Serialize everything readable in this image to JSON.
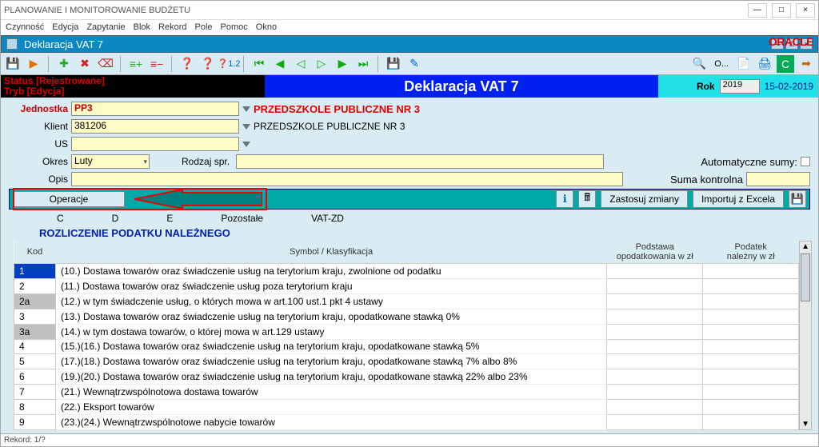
{
  "window": {
    "title": "PLANOWANIE I MONITOROWANIE BUDŻETU",
    "brand": "ORACLE"
  },
  "menu": {
    "items": [
      "Czynność",
      "Edycja",
      "Zapytanie",
      "Blok",
      "Rekord",
      "Pole",
      "Pomoc",
      "Okno"
    ]
  },
  "sub_window": {
    "title": "Deklaracja VAT 7"
  },
  "status_band": {
    "status_label": "Status [Rejestrowane]",
    "mode_label": "Tryb [Edycja]",
    "title": "Deklaracja VAT 7",
    "year_label": "Rok",
    "year_value": "2019",
    "date": "15-02-2019"
  },
  "form": {
    "jednostka_label": "Jednostka",
    "jednostka_value": "PP3",
    "jednostka_name": "PRZEDSZKOLE PUBLICZNE NR 3",
    "klient_label": "Klient",
    "klient_value": "381206",
    "klient_name": "PRZEDSZKOLE PUBLICZNE NR 3",
    "us_label": "US",
    "us_value": "",
    "okres_label": "Okres",
    "okres_value": "Luty",
    "rodzaj_label": "Rodzaj spr.",
    "rodzaj_value": "",
    "auto_sums_label": "Automatyczne sumy:",
    "opis_label": "Opis",
    "opis_value": "",
    "suma_label": "Suma kontrolna",
    "suma_value": ""
  },
  "actions": {
    "operacje": "Operacje",
    "zastosuj": "Zastosuj zmiany",
    "importuj": "Importuj z Excela"
  },
  "tabs": {
    "items": [
      "C",
      "D",
      "E",
      "Pozostałe",
      "VAT-ZD"
    ]
  },
  "section_title": "ROZLICZENIE PODATKU NALEŻNEGO",
  "table": {
    "headers": {
      "kod": "Kod",
      "symbol": "Symbol / Klasyfikacja",
      "podstawa": "Podstawa\nopodatkowania w zł",
      "podatek": "Podatek\nnależny w zł"
    },
    "rows": [
      {
        "kod": "1",
        "shaded": false,
        "first": true,
        "desc": "(10.) Dostawa towarów oraz świadczenie usług na terytorium kraju, zwolnione od podatku"
      },
      {
        "kod": "2",
        "shaded": false,
        "desc": "(11.) Dostawa towarów oraz świadczenie usług poza terytorium kraju"
      },
      {
        "kod": "2a",
        "shaded": true,
        "desc": "(12.) w tym świadczenie usług, o których mowa w art.100 ust.1 pkt 4 ustawy"
      },
      {
        "kod": "3",
        "shaded": false,
        "desc": "(13.) Dostawa towarów oraz świadczenie usług na terytorium kraju, opodatkowane stawką 0%"
      },
      {
        "kod": "3a",
        "shaded": true,
        "desc": "(14.) w tym dostawa towarów, o której mowa w art.129 ustawy"
      },
      {
        "kod": "4",
        "shaded": false,
        "desc": "(15.)(16.) Dostawa towarów oraz świadczenie usług na terytorium kraju, opodatkowane stawką 5%"
      },
      {
        "kod": "5",
        "shaded": false,
        "desc": "(17.)(18.) Dostawa towarów oraz świadczenie usług na terytorium kraju, opodatkowane stawką 7% albo 8%"
      },
      {
        "kod": "6",
        "shaded": false,
        "desc": "(19.)(20.) Dostawa towarów oraz świadczenie usług na terytorium kraju, opodatkowane stawką 22% albo 23%"
      },
      {
        "kod": "7",
        "shaded": false,
        "desc": "(21.) Wewnątrzwspólnotowa dostawa towarów"
      },
      {
        "kod": "8",
        "shaded": false,
        "desc": "(22.) Eksport towarów"
      },
      {
        "kod": "9",
        "shaded": false,
        "desc": "(23.)(24.) Wewnątrzwspólnotowe nabycie towarów"
      }
    ]
  },
  "toolbar_right": {
    "options_label": "O..."
  },
  "statusbar": {
    "record": "Rekord: 1/?"
  }
}
